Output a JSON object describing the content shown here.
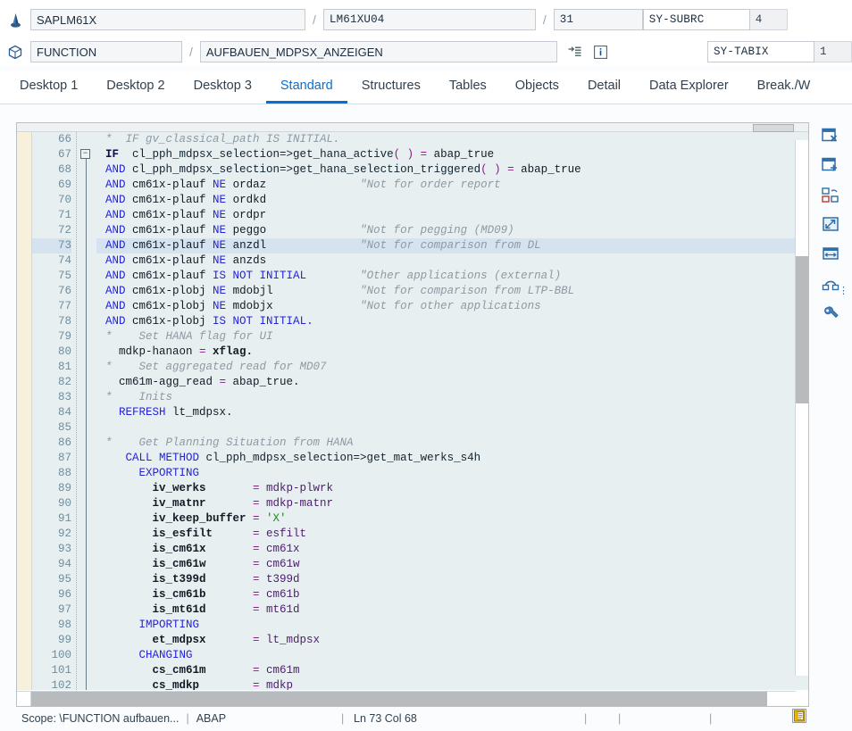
{
  "header": {
    "row1": {
      "icon": "pin-marker-icon",
      "program": "SAPLM61X",
      "sep1": "/",
      "include": "LM61XU04",
      "sep2": "/",
      "line": "31",
      "sy_subrc_label": "SY-SUBRC",
      "sy_subrc_value": "4"
    },
    "row2": {
      "icon": "cube-object-icon",
      "type": "FUNCTION",
      "sep1": "/",
      "name": "AUFBAUEN_MDPSX_ANZEIGEN",
      "goto_icon": "goto-line-icon",
      "info_icon": "info-icon",
      "sy_tabix_label": "SY-TABIX",
      "sy_tabix_value": "1"
    }
  },
  "tabs": [
    {
      "label": "Desktop 1",
      "active": false
    },
    {
      "label": "Desktop 2",
      "active": false
    },
    {
      "label": "Desktop 3",
      "active": false
    },
    {
      "label": "Standard",
      "active": true
    },
    {
      "label": "Structures",
      "active": false
    },
    {
      "label": "Tables",
      "active": false
    },
    {
      "label": "Objects",
      "active": false
    },
    {
      "label": "Detail",
      "active": false
    },
    {
      "label": "Data Explorer",
      "active": false
    },
    {
      "label": "Break./W",
      "active": false
    }
  ],
  "editor": {
    "first_line": 66,
    "highlight_line": 73,
    "fold_marker_line": 67,
    "lines": [
      {
        "n": 66,
        "t": [
          [
            "cm",
            "*  IF gv_classical_path IS INITIAL."
          ]
        ]
      },
      {
        "n": 67,
        "t": [
          [
            "kb",
            "IF"
          ],
          [
            "id",
            "  "
          ],
          [
            "cls",
            "cl_pph_mdpsx_selection=>get_hana_active"
          ],
          [
            "pp",
            "( )"
          ],
          [
            "eq",
            " = "
          ],
          [
            "id",
            "abap_true"
          ]
        ]
      },
      {
        "n": 68,
        "t": [
          [
            "k",
            "AND"
          ],
          [
            "id",
            " "
          ],
          [
            "cls",
            "cl_pph_mdpsx_selection=>get_hana_selection_triggered"
          ],
          [
            "pp",
            "( )"
          ],
          [
            "eq",
            " = "
          ],
          [
            "id",
            "abap_true"
          ]
        ]
      },
      {
        "n": 69,
        "t": [
          [
            "k",
            "AND"
          ],
          [
            "id",
            " cm61x-plauf "
          ],
          [
            "k",
            "NE"
          ],
          [
            "id",
            " ordaz"
          ],
          [
            "cm",
            "              \"Not for order report"
          ]
        ]
      },
      {
        "n": 70,
        "t": [
          [
            "k",
            "AND"
          ],
          [
            "id",
            " cm61x-plauf "
          ],
          [
            "k",
            "NE"
          ],
          [
            "id",
            " ordkd"
          ]
        ]
      },
      {
        "n": 71,
        "t": [
          [
            "k",
            "AND"
          ],
          [
            "id",
            " cm61x-plauf "
          ],
          [
            "k",
            "NE"
          ],
          [
            "id",
            " ordpr"
          ]
        ]
      },
      {
        "n": 72,
        "t": [
          [
            "k",
            "AND"
          ],
          [
            "id",
            " cm61x-plauf "
          ],
          [
            "k",
            "NE"
          ],
          [
            "id",
            " peggo"
          ],
          [
            "cm",
            "              \"Not for pegging (MD09)"
          ]
        ]
      },
      {
        "n": 73,
        "t": [
          [
            "k",
            "AND"
          ],
          [
            "id",
            " cm61x-plauf "
          ],
          [
            "k",
            "NE"
          ],
          [
            "id",
            " anzdl"
          ],
          [
            "cm",
            "              \"Not for comparison from DL"
          ]
        ]
      },
      {
        "n": 74,
        "t": [
          [
            "k",
            "AND"
          ],
          [
            "id",
            " cm61x-plauf "
          ],
          [
            "k",
            "NE"
          ],
          [
            "id",
            " anzds"
          ]
        ]
      },
      {
        "n": 75,
        "t": [
          [
            "k",
            "AND"
          ],
          [
            "id",
            " cm61x-plauf "
          ],
          [
            "k",
            "IS NOT INITIAL"
          ],
          [
            "cm",
            "        \"Other applications (external)"
          ]
        ]
      },
      {
        "n": 76,
        "t": [
          [
            "k",
            "AND"
          ],
          [
            "id",
            " cm61x-plobj "
          ],
          [
            "k",
            "NE"
          ],
          [
            "id",
            " mdobjl"
          ],
          [
            "cm",
            "             \"Not for comparison from LTP-BBL"
          ]
        ]
      },
      {
        "n": 77,
        "t": [
          [
            "k",
            "AND"
          ],
          [
            "id",
            " cm61x-plobj "
          ],
          [
            "k",
            "NE"
          ],
          [
            "id",
            " mdobjx"
          ],
          [
            "cm",
            "             \"Not for other applications"
          ]
        ]
      },
      {
        "n": 78,
        "t": [
          [
            "k",
            "AND"
          ],
          [
            "id",
            " cm61x-plobj "
          ],
          [
            "k",
            "IS NOT INITIAL."
          ]
        ]
      },
      {
        "n": 79,
        "t": [
          [
            "cm",
            "*    Set HANA flag for UI"
          ]
        ]
      },
      {
        "n": 80,
        "t": [
          [
            "id",
            "  mdkp-hanaon "
          ],
          [
            "eq",
            "= "
          ],
          [
            "pn",
            "xflag."
          ]
        ]
      },
      {
        "n": 81,
        "t": [
          [
            "cm",
            "*    Set aggregated read for MD07"
          ]
        ]
      },
      {
        "n": 82,
        "t": [
          [
            "id",
            "  cm61m-agg_read "
          ],
          [
            "eq",
            "= "
          ],
          [
            "id",
            "abap_true."
          ]
        ]
      },
      {
        "n": 83,
        "t": [
          [
            "cm",
            "*    Inits"
          ]
        ]
      },
      {
        "n": 84,
        "t": [
          [
            "k",
            "  REFRESH"
          ],
          [
            "id",
            " lt_mdpsx."
          ]
        ]
      },
      {
        "n": 85,
        "t": [
          [
            "id",
            ""
          ]
        ]
      },
      {
        "n": 86,
        "t": [
          [
            "cm",
            "*    Get Planning Situation from HANA"
          ]
        ]
      },
      {
        "n": 87,
        "t": [
          [
            "k",
            "   CALL METHOD"
          ],
          [
            "cls",
            " cl_pph_mdpsx_selection=>get_mat_werks_s4h"
          ]
        ]
      },
      {
        "n": 88,
        "t": [
          [
            "k",
            "     EXPORTING"
          ]
        ]
      },
      {
        "n": 89,
        "t": [
          [
            "pn",
            "       iv_werks       "
          ],
          [
            "eq",
            "= "
          ],
          [
            "vl",
            "mdkp-plwrk"
          ]
        ]
      },
      {
        "n": 90,
        "t": [
          [
            "pn",
            "       iv_matnr       "
          ],
          [
            "eq",
            "= "
          ],
          [
            "vl",
            "mdkp-matnr"
          ]
        ]
      },
      {
        "n": 91,
        "t": [
          [
            "pn",
            "       iv_keep_buffer "
          ],
          [
            "eq",
            "= "
          ],
          [
            "st",
            "'X'"
          ]
        ]
      },
      {
        "n": 92,
        "t": [
          [
            "pn",
            "       is_esfilt      "
          ],
          [
            "eq",
            "= "
          ],
          [
            "vl",
            "esfilt"
          ]
        ]
      },
      {
        "n": 93,
        "t": [
          [
            "pn",
            "       is_cm61x       "
          ],
          [
            "eq",
            "= "
          ],
          [
            "vl",
            "cm61x"
          ]
        ]
      },
      {
        "n": 94,
        "t": [
          [
            "pn",
            "       is_cm61w       "
          ],
          [
            "eq",
            "= "
          ],
          [
            "vl",
            "cm61w"
          ]
        ]
      },
      {
        "n": 95,
        "t": [
          [
            "pn",
            "       is_t399d       "
          ],
          [
            "eq",
            "= "
          ],
          [
            "vl",
            "t399d"
          ]
        ]
      },
      {
        "n": 96,
        "t": [
          [
            "pn",
            "       is_cm61b       "
          ],
          [
            "eq",
            "= "
          ],
          [
            "vl",
            "cm61b"
          ]
        ]
      },
      {
        "n": 97,
        "t": [
          [
            "pn",
            "       is_mt61d       "
          ],
          [
            "eq",
            "= "
          ],
          [
            "vl",
            "mt61d"
          ]
        ]
      },
      {
        "n": 98,
        "t": [
          [
            "k",
            "     IMPORTING"
          ]
        ]
      },
      {
        "n": 99,
        "t": [
          [
            "pn",
            "       et_mdpsx       "
          ],
          [
            "eq",
            "= "
          ],
          [
            "vl",
            "lt_mdpsx"
          ]
        ]
      },
      {
        "n": 100,
        "t": [
          [
            "k",
            "     CHANGING"
          ]
        ]
      },
      {
        "n": 101,
        "t": [
          [
            "pn",
            "       cs_cm61m       "
          ],
          [
            "eq",
            "= "
          ],
          [
            "vl",
            "cm61m"
          ]
        ]
      },
      {
        "n": 102,
        "t": [
          [
            "pn",
            "       cs_mdkp        "
          ],
          [
            "eq",
            "= "
          ],
          [
            "vl",
            "mdkp"
          ]
        ]
      }
    ]
  },
  "rail_icons": [
    "close-window-icon",
    "new-window-icon",
    "change-layout-icon",
    "resize-window-icon",
    "fit-width-icon",
    "link-connector-icon",
    "settings-wrench-icon"
  ],
  "status": {
    "scope": "Scope: \\FUNCTION aufbauen...",
    "sep": "|",
    "language": "ABAP",
    "position": "Ln  73 Col  68",
    "clipboard_icon": "clipboard-icon"
  },
  "colors": {
    "accent": "#0a6ed1",
    "keyword": "#2323dd",
    "comment": "#8d9aa3",
    "string": "#1a8a1a",
    "highlight_row": "#d5e2f0",
    "code_bg": "#e8eff1",
    "breakpoint_margin": "#f7f0dc"
  }
}
